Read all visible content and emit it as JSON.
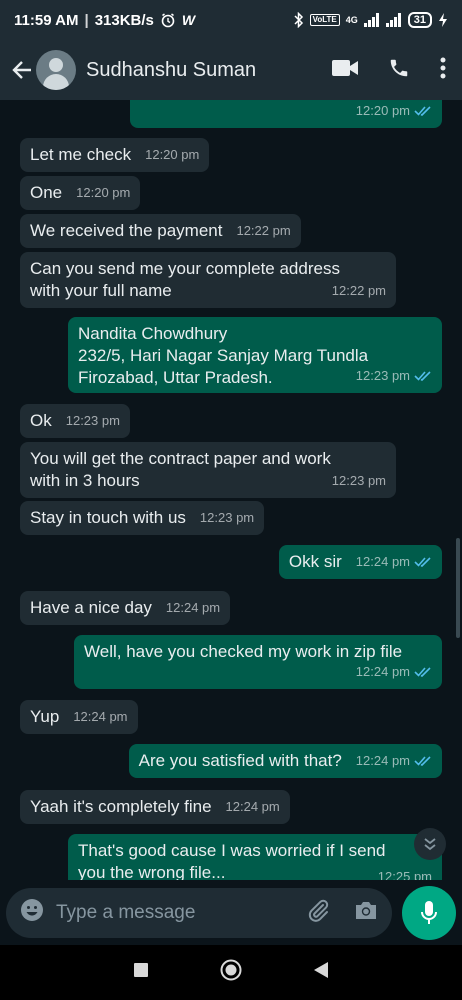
{
  "status_bar": {
    "time": "11:59 AM",
    "speed": "313KB/s",
    "network_label": "4G",
    "battery": "31"
  },
  "header": {
    "contact_name": "Sudhanshu Suman"
  },
  "messages": [
    {
      "direction": "out",
      "text": "",
      "time": "12:20 pm",
      "read": true
    },
    {
      "direction": "in",
      "text": "Let me check",
      "time": "12:20 pm"
    },
    {
      "direction": "in",
      "text": "One",
      "time": "12:20 pm"
    },
    {
      "direction": "in",
      "text": "We received the payment",
      "time": "12:22 pm"
    },
    {
      "direction": "in",
      "text": "Can you send me your complete address\nwith your full name",
      "time": "12:22 pm"
    },
    {
      "direction": "out",
      "text": "Nandita Chowdhury\n232/5, Hari Nagar Sanjay Marg Tundla\nFirozabad, Uttar Pradesh.",
      "time": "12:23 pm",
      "read": true
    },
    {
      "direction": "in",
      "text": "Ok",
      "time": "12:23 pm"
    },
    {
      "direction": "in",
      "text": "You will get the contract paper and work\nwith in 3 hours",
      "time": "12:23 pm"
    },
    {
      "direction": "in",
      "text": "Stay in touch with us",
      "time": "12:23 pm"
    },
    {
      "direction": "out",
      "text": "Okk sir",
      "time": "12:24 pm",
      "read": true
    },
    {
      "direction": "in",
      "text": "Have a nice day",
      "time": "12:24 pm"
    },
    {
      "direction": "out",
      "text": "Well, have you checked my work in zip file",
      "time": "12:24 pm",
      "read": true
    },
    {
      "direction": "in",
      "text": "Yup",
      "time": "12:24 pm"
    },
    {
      "direction": "out",
      "text": "Are you satisfied with that?",
      "time": "12:24 pm",
      "read": true
    },
    {
      "direction": "in",
      "text": "Yaah it's completely fine",
      "time": "12:24 pm"
    },
    {
      "direction": "out",
      "text": "That's good cause I was worried if I send\nyou the wrong file...",
      "time": "12:25 pm",
      "read": false
    }
  ],
  "composer": {
    "placeholder": "Type a message"
  },
  "colors": {
    "incoming_bubble": "#202c33",
    "outgoing_bubble": "#005c4b",
    "accent": "#00a884",
    "read_ticks": "#53bdeb"
  }
}
